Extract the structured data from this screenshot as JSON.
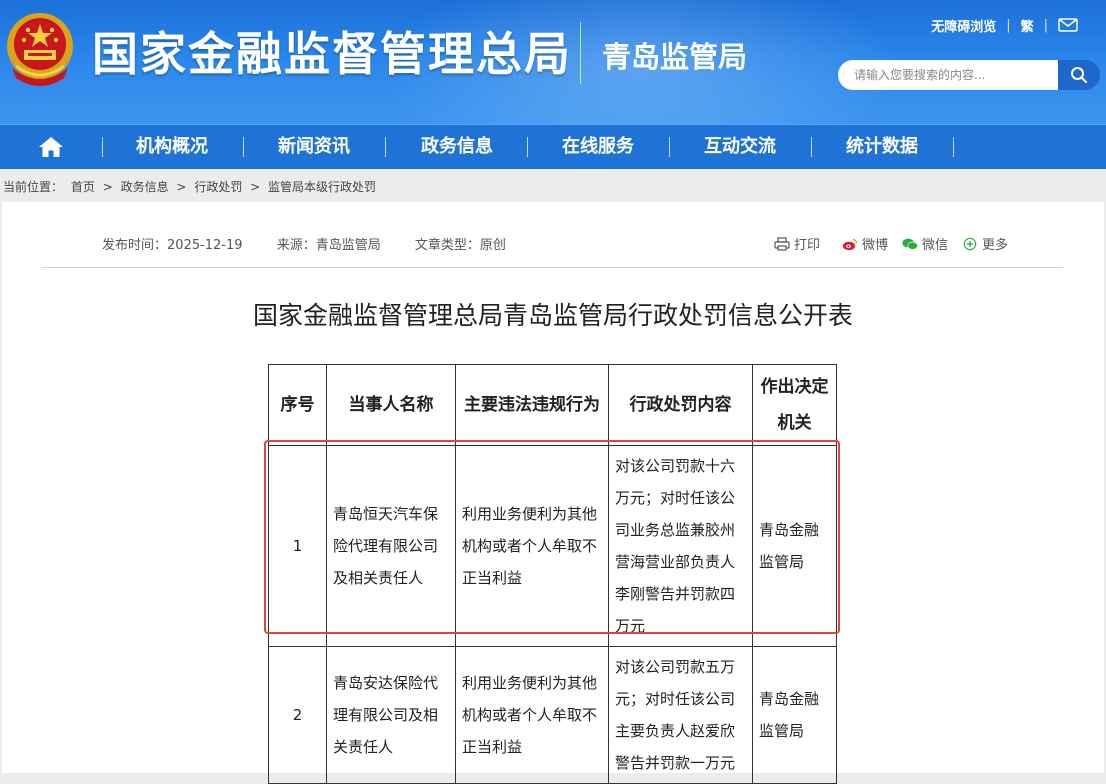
{
  "header": {
    "org_title": "国家金融监督管理总局",
    "sub_org": "青岛监管局",
    "links": [
      "无障碍浏览",
      "繁"
    ],
    "separator": "|",
    "search_placeholder": "请输入您要搜索的内容..."
  },
  "nav": {
    "items": [
      "机构概况",
      "新闻资讯",
      "政务信息",
      "在线服务",
      "互动交流",
      "统计数据"
    ]
  },
  "breadcrumb": {
    "label": "当前位置：",
    "items": [
      "首页",
      "政务信息",
      "行政处罚",
      "监管局本级行政处罚"
    ],
    "separator": ">"
  },
  "article": {
    "publish_time": "发布时间：2025-12-19",
    "source": "来源：青岛监管局",
    "type": "文章类型：原创",
    "share": {
      "print": "打印",
      "weibo": "微博",
      "wechat": "微信",
      "more": "更多"
    },
    "title": "国家金融监督管理总局青岛监管局行政处罚信息公开表"
  },
  "table": {
    "headers": [
      "序号",
      "当事人名称",
      "主要违法违规行为",
      "行政处罚内容",
      "作出决定机关"
    ],
    "rows": [
      {
        "no": "1",
        "party": "青岛恒天汽车保险代理有限公司及相关责任人",
        "violation": "利用业务便利为其他机构或者个人牟取不正当利益",
        "penalty": "对该公司罚款十六万元；对时任该公司业务总监兼胶州营海营业部负责人李刚警告并罚款四万元",
        "authority": "青岛金融监管局"
      },
      {
        "no": "2",
        "party": "青岛安达保险代理有限公司及相关责任人",
        "violation": "利用业务便利为其他机构或者个人牟取不正当利益",
        "penalty": "对该公司罚款五万元；对时任该公司主要负责人赵爱欣警告并罚款一万元",
        "authority": "青岛金融监管局"
      }
    ]
  },
  "colors": {
    "banner": "#2a86ea",
    "nav": "#1f73d6",
    "highlight": "#e0453a"
  }
}
